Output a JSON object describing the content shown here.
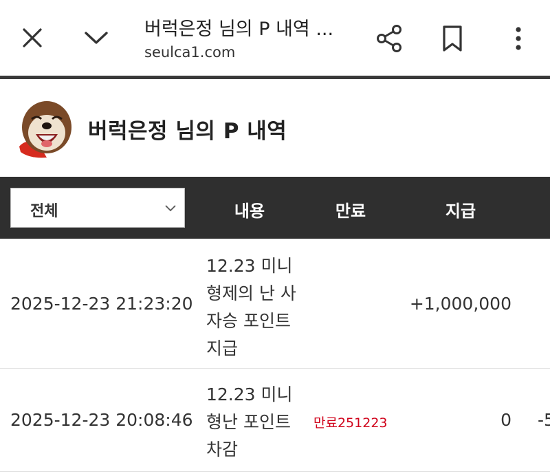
{
  "browser": {
    "title": "버럭은정 님의 P 내역 ...",
    "url": "seulca1.com",
    "icons": {
      "close": "close-icon",
      "chevron": "chevron-down-icon",
      "share": "share-icon",
      "bookmark": "bookmark-icon",
      "more": "more-vert-icon"
    }
  },
  "page": {
    "title": "버럭은정 님의 P 내역",
    "avatar": "otter-mascot-avatar"
  },
  "table": {
    "filter_value": "전체",
    "headers": {
      "content": "내용",
      "expire": "만료",
      "pay": "지급"
    },
    "rows": [
      {
        "date": "2025-12-23 21:23:20",
        "desc": "12.23 미니 형제의 난 사자승 포인트지급",
        "expire": "",
        "pay": "+1,000,000",
        "extra": ""
      },
      {
        "date": "2025-12-23 20:08:46",
        "desc": "12.23 미니형난 포인트 차감",
        "expire": "만료251223",
        "pay": "0",
        "extra": "-5"
      }
    ]
  },
  "colors": {
    "header_bg": "#2f2f2f",
    "expire_text": "#d0021b",
    "divider": "#3a3a3a"
  }
}
